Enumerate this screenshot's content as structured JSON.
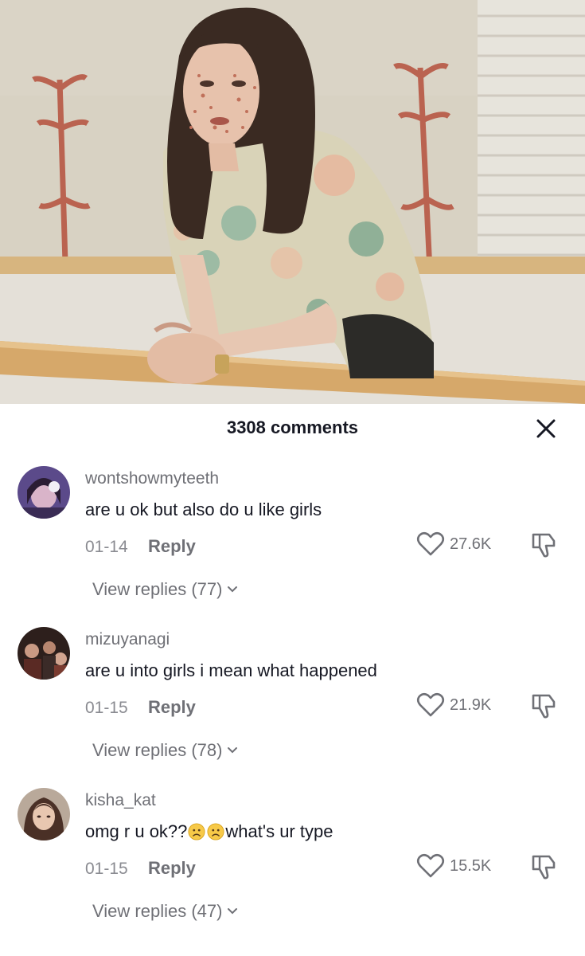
{
  "sheet": {
    "title": "3308 comments"
  },
  "comments": [
    {
      "username": "wontshowmyteeth",
      "text": "are u ok but also do u like girls",
      "date": "01-14",
      "reply_label": "Reply",
      "likes": "27.6K",
      "view_replies": "View replies (77)"
    },
    {
      "username": "mizuyanagi",
      "text": "are u into girls i mean what happened",
      "date": "01-15",
      "reply_label": "Reply",
      "likes": "21.9K",
      "view_replies": "View replies (78)"
    },
    {
      "username": "kisha_kat",
      "text_before": "omg r u ok??",
      "text_after": "what's ur type",
      "date": "01-15",
      "reply_label": "Reply",
      "likes": "15.5K",
      "view_replies": "View replies (47)"
    }
  ],
  "icons": {
    "close": "close-icon",
    "like": "heart-outline-icon",
    "dislike": "thumbs-down-icon",
    "chevron": "chevron-down-icon",
    "emoji": "frowning-face-emoji"
  },
  "colors": {
    "text_primary": "#161823",
    "text_secondary": "#6f7076",
    "background": "#ffffff"
  }
}
